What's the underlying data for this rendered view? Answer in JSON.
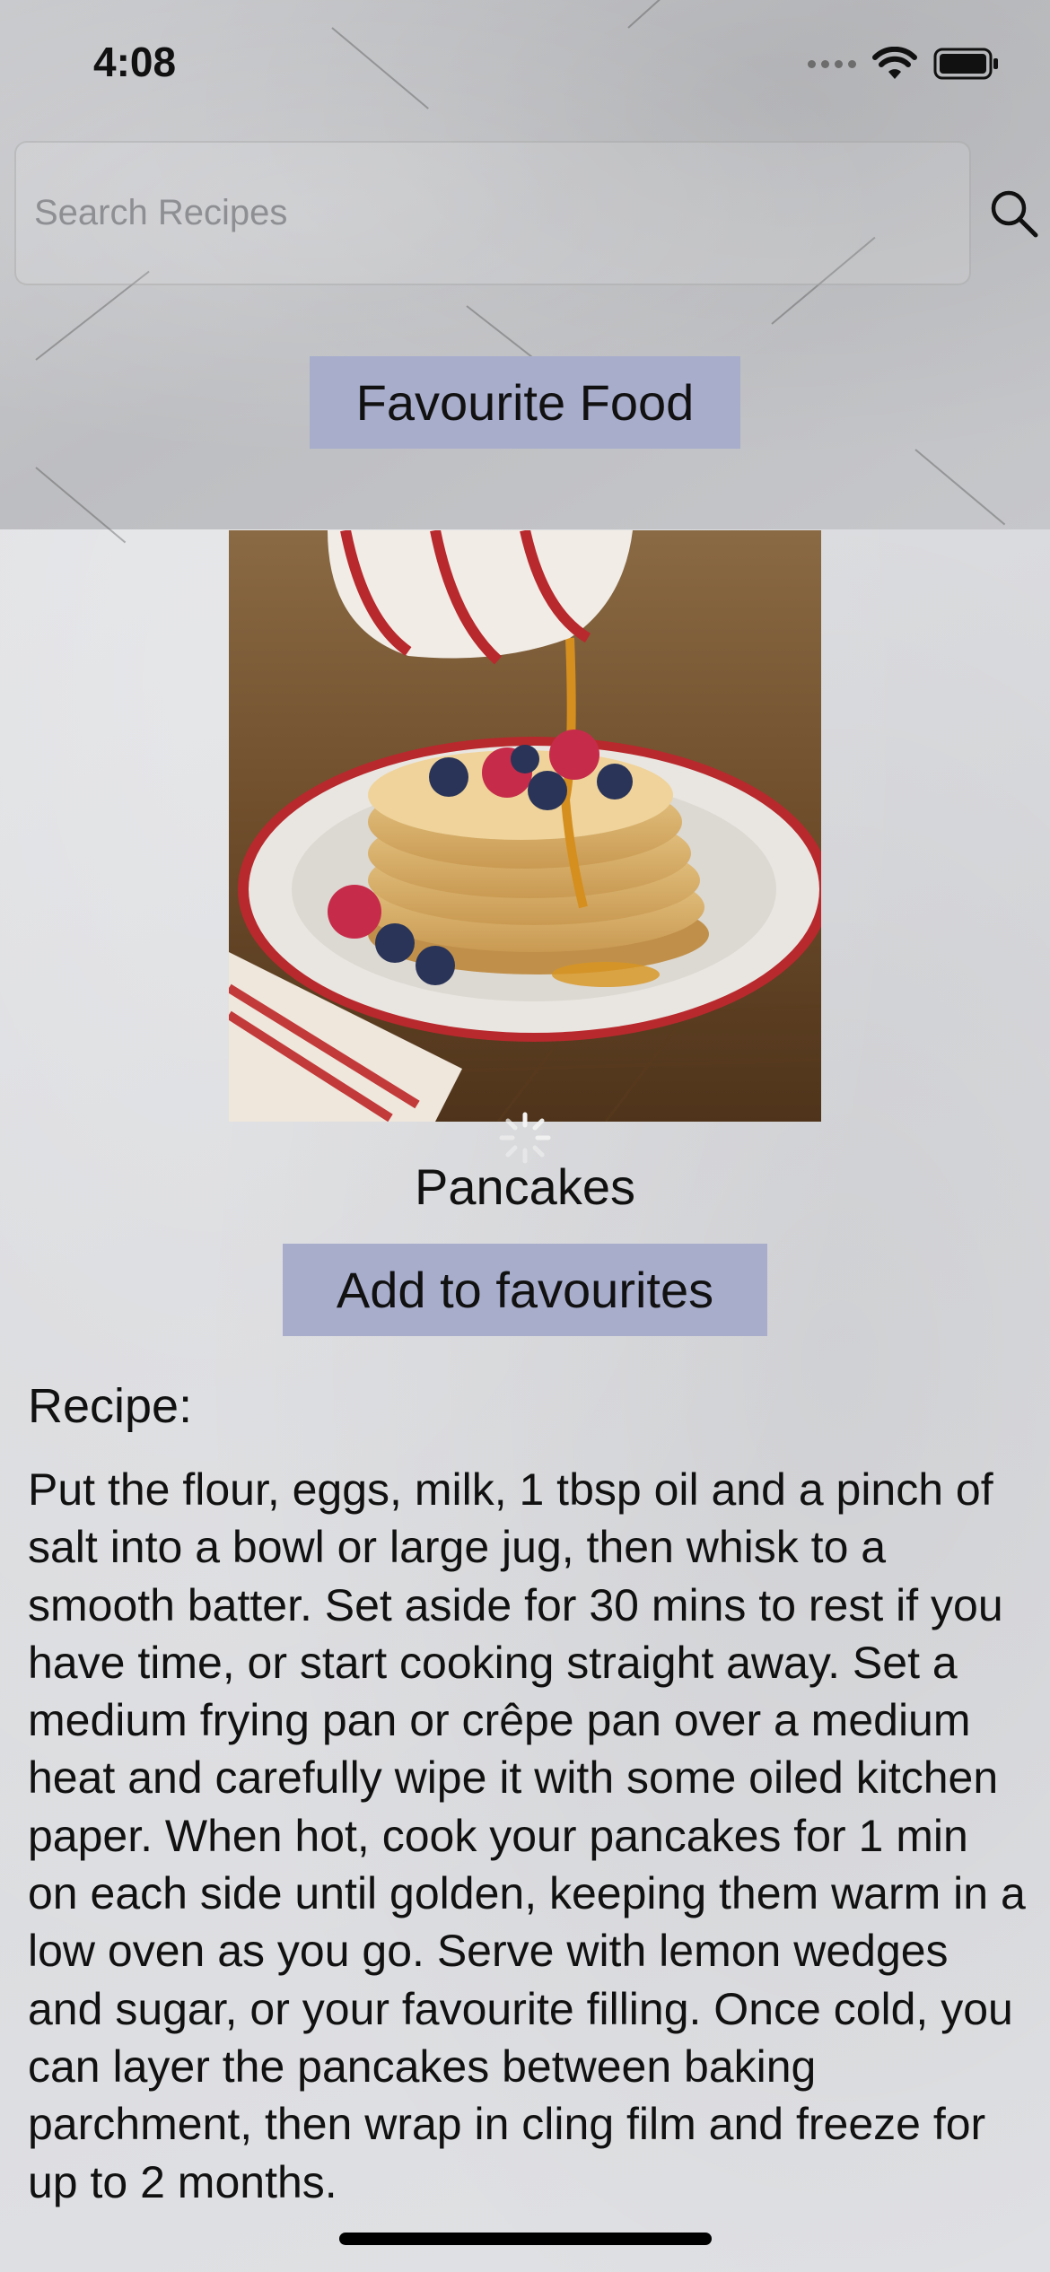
{
  "status_bar": {
    "time": "4:08"
  },
  "search": {
    "placeholder": "Search Recipes"
  },
  "header": {
    "title": "Favourite Food"
  },
  "recipe": {
    "name": "Pancakes",
    "add_button_label": "Add to favourites",
    "section_label": "Recipe:",
    "instructions": "Put the flour, eggs, milk, 1 tbsp oil and a pinch of salt into a bowl or large jug, then whisk to a smooth batter. Set aside for 30 mins to rest if you have time, or start cooking straight away. Set a medium frying pan or crêpe pan over a medium heat and carefully wipe it with some oiled kitchen paper. When hot, cook your pancakes for 1 min on each side until golden, keeping them warm in a low oven as you go. Serve with lemon wedges and sugar, or your favourite filling. Once cold, you can layer the pancakes between baking parchment, then wrap in cling film and freeze for up to 2 months."
  },
  "icons": {
    "search": "search-icon",
    "wifi": "wifi-icon",
    "battery": "battery-icon",
    "cellular": "cellular-signal-icon",
    "spinner": "loading-spinner-icon"
  },
  "colors": {
    "button_bg": "#a8adcc",
    "text": "#111111",
    "placeholder": "#8e8f93"
  }
}
